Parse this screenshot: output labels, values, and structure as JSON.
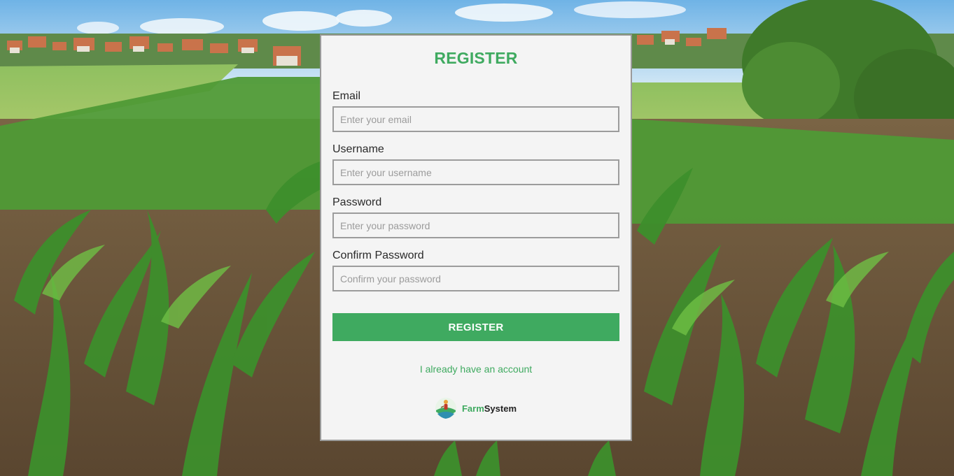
{
  "form": {
    "title": "REGISTER",
    "fields": [
      {
        "label": "Email",
        "placeholder": "Enter your email"
      },
      {
        "label": "Username",
        "placeholder": "Enter your username"
      },
      {
        "label": "Password",
        "placeholder": "Enter your password"
      },
      {
        "label": "Confirm Password",
        "placeholder": "Confirm your password"
      }
    ],
    "submit_label": "REGISTER",
    "login_link": "I already have an account"
  },
  "brand": {
    "name_part1": "Farm",
    "name_part2": "System"
  },
  "colors": {
    "accent": "#3faa60",
    "card_bg": "#f4f4f4"
  },
  "icons": {
    "brand_logo": "farmer-field-icon"
  }
}
